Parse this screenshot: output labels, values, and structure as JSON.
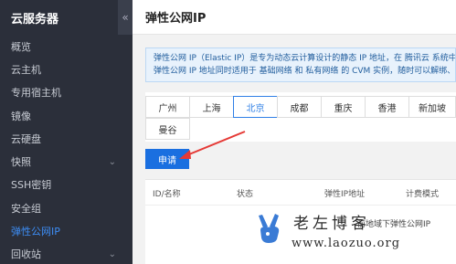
{
  "sidebar": {
    "title": "云服务器",
    "collapse_glyph": "«",
    "items": [
      {
        "label": "概览",
        "chevron": ""
      },
      {
        "label": "云主机",
        "chevron": ""
      },
      {
        "label": "专用宿主机",
        "chevron": ""
      },
      {
        "label": "镜像",
        "chevron": ""
      },
      {
        "label": "云硬盘",
        "chevron": ""
      },
      {
        "label": "快照",
        "chevron": "⌄"
      },
      {
        "label": "SSH密钥",
        "chevron": ""
      },
      {
        "label": "安全组",
        "chevron": ""
      },
      {
        "label": "弹性公网IP",
        "chevron": ""
      },
      {
        "label": "回收站",
        "chevron": "⌄"
      }
    ],
    "active_index": 8
  },
  "header": {
    "title": "弹性公网IP"
  },
  "info": {
    "line1": "弹性公网 IP（Elastic IP）是专为动态云计算设计的静态 IP 地址，在 腾讯云 系统中 E",
    "line2": "弹性公网 IP 地址同时适用于 基础网络 和 私有网络 的 CVM 实例，随时可以解绑、再"
  },
  "regions": {
    "items": [
      "广州",
      "上海",
      "北京",
      "成都",
      "重庆",
      "香港",
      "新加坡",
      "曼谷"
    ],
    "selected": "北京"
  },
  "apply_button": {
    "label": "申请"
  },
  "table": {
    "columns": [
      "ID/名称",
      "状态",
      "弹性IP地址",
      "计费模式"
    ],
    "empty_text": "前地域下弹性公网IP"
  },
  "watermark": {
    "name": "老左博客",
    "url": "www.laozuo.org"
  },
  "colors": {
    "sidebar_bg": "#2b2f3a",
    "accent": "#1a6fe0",
    "active": "#3d8ef6",
    "arrow": "#e53935"
  }
}
